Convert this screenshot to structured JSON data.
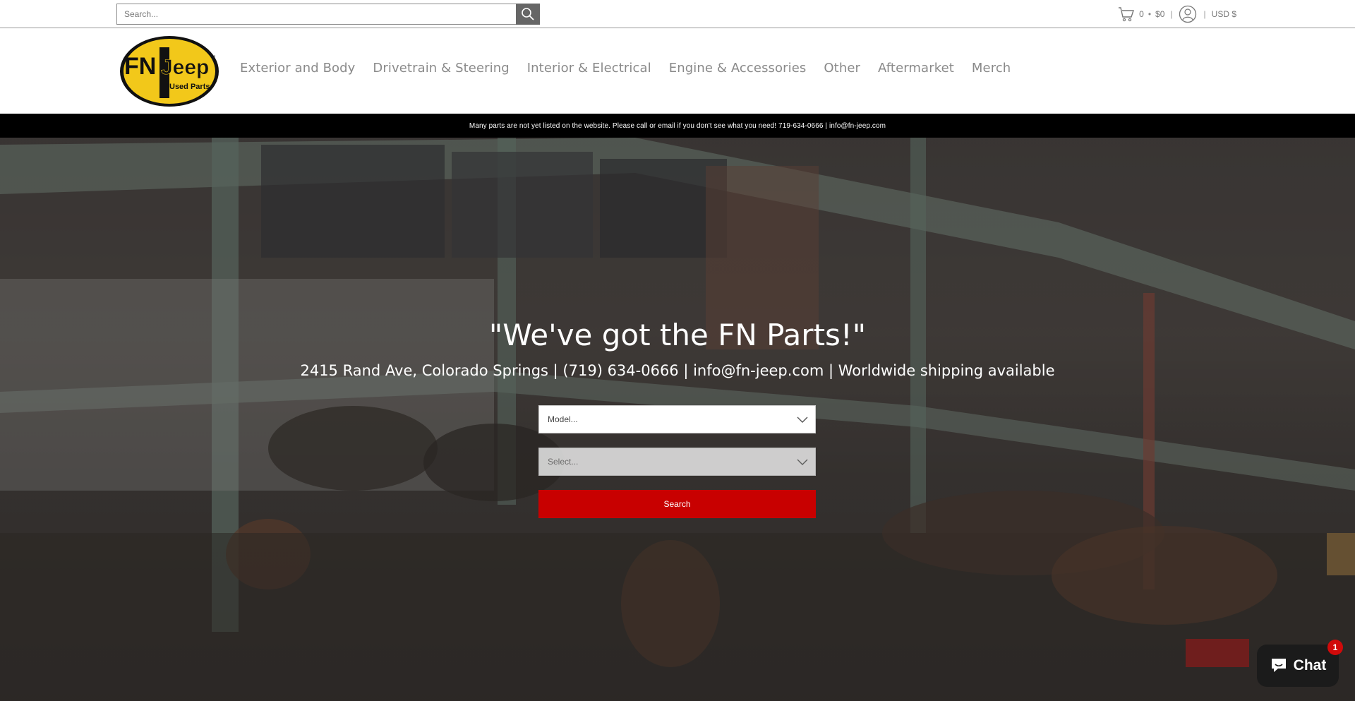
{
  "search": {
    "placeholder": "Search..."
  },
  "cart": {
    "count": "0",
    "total": "$0",
    "currency": "USD $"
  },
  "logo": {
    "text_main": "FN",
    "text_brand": "Jeep",
    "text_sub": "Used Parts",
    "tm": "™"
  },
  "nav": {
    "items": [
      "Exterior and Body",
      "Drivetrain & Steering",
      "Interior & Electrical",
      "Engine & Accessories",
      "Other",
      "Aftermarket",
      "Merch"
    ]
  },
  "announcement": "Many parts are not yet listed on the website. Please call or email if you don't see what you need! 719-634-0666 | info@fn-jeep.com",
  "hero": {
    "title": "\"We've got the FN Parts!\"",
    "subtitle": "2415 Rand Ave, Colorado Springs | (719) 634-0666 | info@fn-jeep.com | Worldwide shipping available",
    "model_select": "Model...",
    "part_select": "Select...",
    "search_button": "Search"
  },
  "chat": {
    "label": "Chat",
    "badge": "1"
  },
  "colors": {
    "accent_red": "#c80000",
    "logo_yellow": "#f2c81a",
    "announce_bg": "#000000"
  }
}
